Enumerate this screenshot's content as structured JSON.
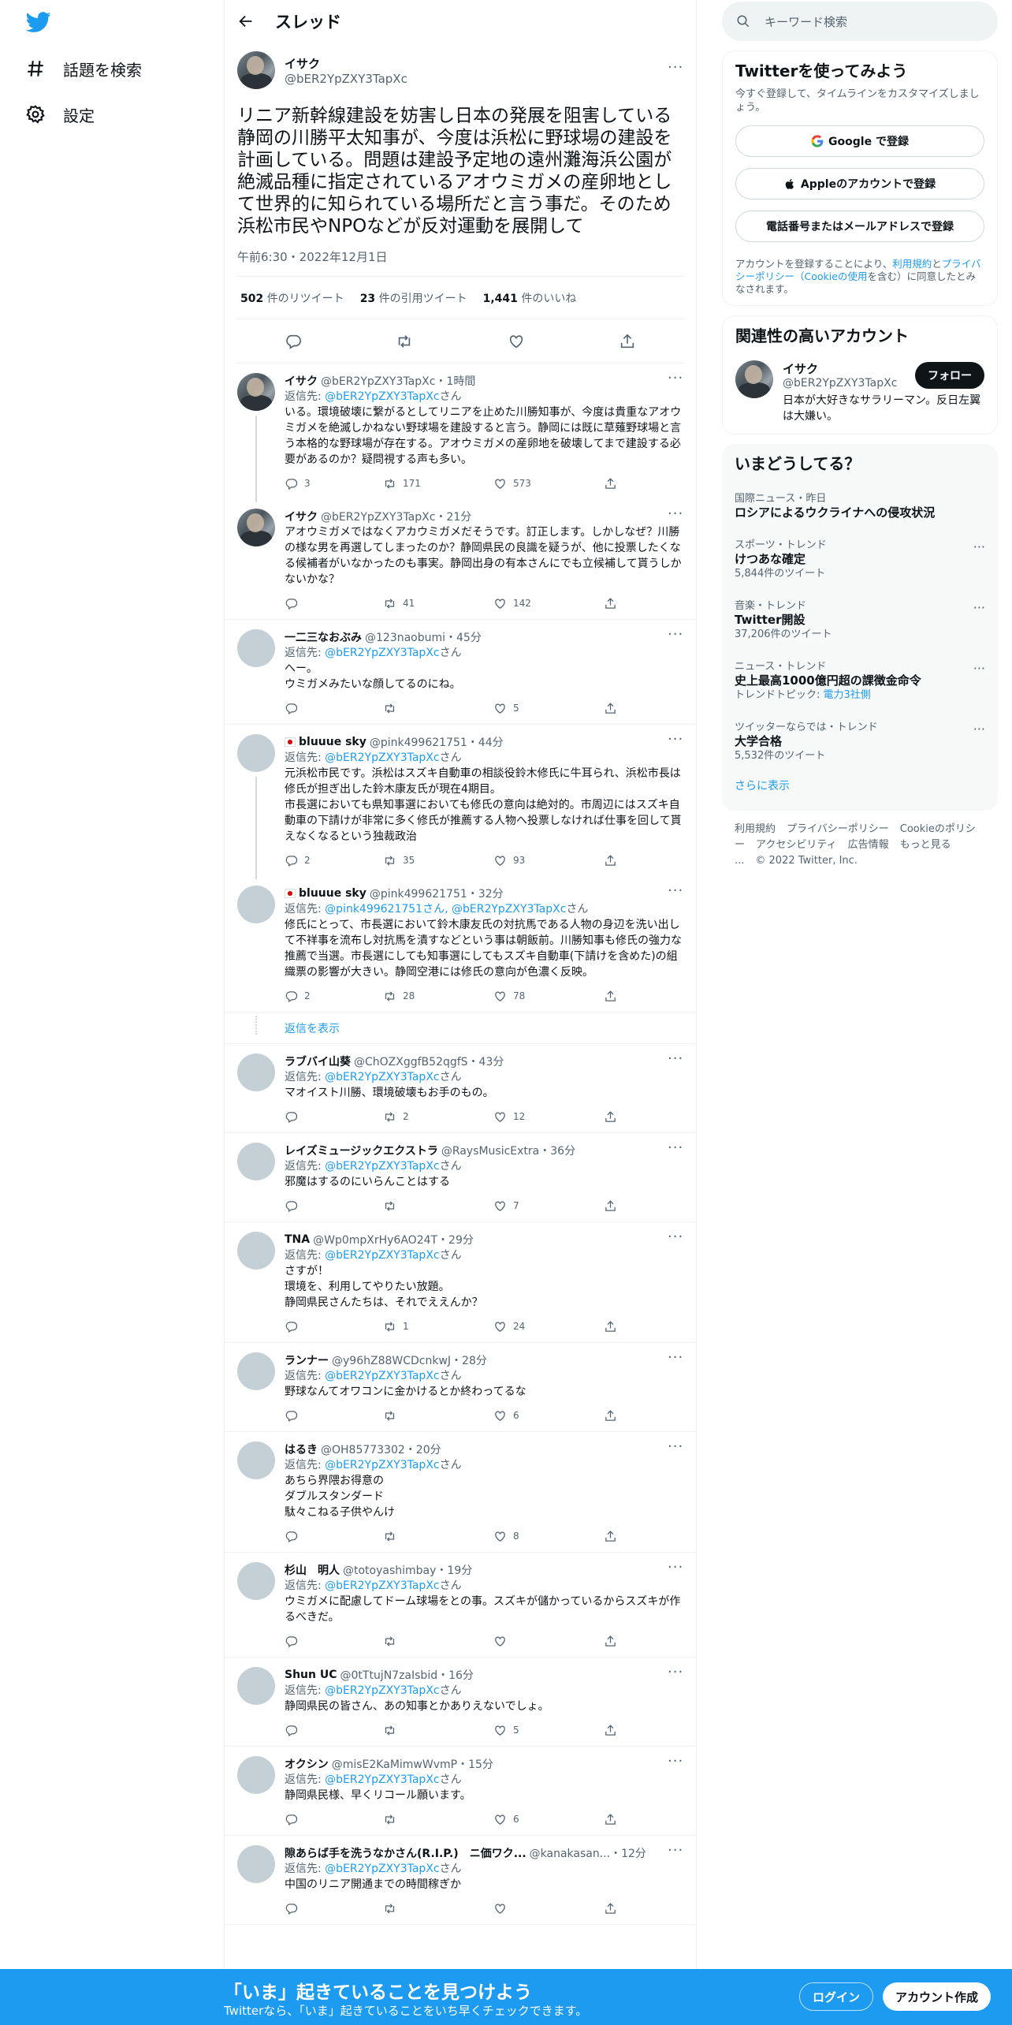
{
  "nav": {
    "items": [
      {
        "label": "話題を検索"
      },
      {
        "label": "設定"
      }
    ]
  },
  "header": {
    "title": "スレッド"
  },
  "tweet": {
    "name": "イサク",
    "handle": "@bER2YpZXY3TapXc",
    "text": "リニア新幹線建設を妨害し日本の発展を阻害している静岡の川勝平太知事が、今度は浜松に野球場の建設を計画している。問題は建設予定地の遠州灘海浜公園が絶滅品種に指定されているアオウミガメの産卵地として世界的に知られている場所だと言う事だ。そのため浜松市民やNPOなどが反対運動を展開して",
    "date": "午前6:30・2022年12月1日",
    "retweets": "502",
    "retweets_label": "件のリツイート",
    "quotes": "23",
    "quotes_label": "件の引用ツイート",
    "likes": "1,441",
    "likes_label": "件のいいね"
  },
  "reply_to_prefix": "返信先: ",
  "reply_suffix": "さん",
  "replies": [
    {
      "name": "イサク",
      "handle": "@bER2YpZXY3TapXc・1時間",
      "to": "@bER2YpZXY3TapXc",
      "text": "いる。環境破壊に繋がるとしてリニアを止めた川勝知事が、今度は貴重なアオウミガメを絶滅しかねない野球場を建設すると言う。静岡には既に草薙野球場と言う本格的な野球場が存在する。アオウミガメの産卵地を破壊してまで建設する必要があるのか？疑問視する声も多い。",
      "reply": "3",
      "rt": "171",
      "like": "573",
      "photo": true,
      "thread": true
    },
    {
      "name": "イサク",
      "handle": "@bER2YpZXY3TapXc・21分",
      "to": "",
      "text": "アオウミガメではなくアカウミガメだそうです。訂正します。しかしなぜ？川勝の様な男を再選してしまったのか？静岡県民の良識を疑うが、他に投票したくなる候補者がいなかったのも事実。静岡出身の有本さんにでも立候補して貰うしかないかな？",
      "reply": "",
      "rt": "41",
      "like": "142",
      "photo": true,
      "thread": false
    },
    {
      "name": "一二三なおぶみ",
      "handle": "@123naobumi・45分",
      "to": "@bER2YpZXY3TapXc",
      "text": "へー。\nウミガメみたいな顔してるのにね。",
      "reply": "",
      "rt": "",
      "like": "5",
      "photo": false,
      "thread": false
    },
    {
      "name": "bluuue sky",
      "handle": "@pink499621751・44分",
      "to": "@bER2YpZXY3TapXc",
      "text": "元浜松市民です。浜松はスズキ自動車の相談役鈴木修氏に牛耳られ、浜松市長は修氏が担ぎ出した鈴木康友氏が現在4期目。\n市長選においても県知事選においても修氏の意向は絶対的。市周辺にはスズキ自動車の下請けが非常に多く修氏が推薦する人物へ投票しなければ仕事を回して貰えなくなるという独裁政治",
      "reply": "2",
      "rt": "35",
      "like": "93",
      "photo": false,
      "thread": true,
      "flag": true
    },
    {
      "name": "bluuue sky",
      "handle": "@pink499621751・32分",
      "to": "@pink499621751さん, @bER2YpZXY3TapXc",
      "text": "修氏にとって、市長選において鈴木康友氏の対抗馬である人物の身辺を洗い出して不祥事を流布し対抗馬を潰すなどという事は朝飯前。川勝知事も修氏の強力な推薦で当選。市長選にしても知事選にしてもスズキ自動車(下請けを含めた)の組織票の影響が大きい。静岡空港には修氏の意向が色濃く反映。",
      "reply": "2",
      "rt": "28",
      "like": "78",
      "photo": false,
      "thread": false,
      "flag": true,
      "show_replies": "返信を表示"
    },
    {
      "name": "ラブバイ山葵",
      "handle": "@ChOZXggfB52qgfS・43分",
      "to": "@bER2YpZXY3TapXc",
      "text": "マオイスト川勝、環境破壊もお手のもの。",
      "reply": "",
      "rt": "2",
      "like": "12",
      "photo": false,
      "thread": false
    },
    {
      "name": "レイズミュージックエクストラ",
      "handle": "@RaysMusicExtra・36分",
      "to": "@bER2YpZXY3TapXc",
      "text": "邪魔はするのにいらんことはする",
      "reply": "",
      "rt": "",
      "like": "7",
      "photo": false,
      "thread": false
    },
    {
      "name": "TNA",
      "handle": "@Wp0mpXrHy6AO24T・29分",
      "to": "@bER2YpZXY3TapXc",
      "text": "さすが！\n環境を、利用してやりたい放題。\n静岡県民さんたちは、それでええんか？",
      "reply": "",
      "rt": "1",
      "like": "24",
      "photo": false,
      "thread": false
    },
    {
      "name": "ランナー",
      "handle": "@y96hZ88WCDcnkwJ・28分",
      "to": "@bER2YpZXY3TapXc",
      "text": "野球なんてオワコンに金かけるとか終わってるな",
      "reply": "",
      "rt": "",
      "like": "6",
      "photo": false,
      "thread": false
    },
    {
      "name": "はるき",
      "handle": "@OH85773302・20分",
      "to": "@bER2YpZXY3TapXc",
      "text": "あちら界隈お得意の\nダブルスタンダード\n駄々こねる子供やんけ",
      "reply": "",
      "rt": "",
      "like": "8",
      "photo": false,
      "thread": false
    },
    {
      "name": "杉山　明人",
      "handle": "@totoyashimbay・19分",
      "to": "@bER2YpZXY3TapXc",
      "text": "ウミガメに配慮してドーム球場をとの事。スズキが儲かっているからスズキが作るべきだ。",
      "reply": "",
      "rt": "",
      "like": "",
      "photo": false,
      "thread": false
    },
    {
      "name": "Shun UC",
      "handle": "@0tTtujN7zaIsbid・16分",
      "to": "@bER2YpZXY3TapXc",
      "text": "静岡県民の皆さん、あの知事とかありえないでしょ。",
      "reply": "",
      "rt": "",
      "like": "5",
      "photo": false,
      "thread": false
    },
    {
      "name": "オクシン",
      "handle": "@misE2KaMimwWvmP・15分",
      "to": "@bER2YpZXY3TapXc",
      "text": "静岡県民様、早くリコール願います。",
      "reply": "",
      "rt": "",
      "like": "6",
      "photo": false,
      "thread": false
    },
    {
      "name": "隙あらば手を洗うなかさん(R.I.P.)　ニ価ワク...",
      "handle": "@kanakasan...・12分",
      "to": "@bER2YpZXY3TapXc",
      "text": "中国のリニア開通までの時間稼ぎか",
      "reply": "",
      "rt": "",
      "like": "",
      "photo": false,
      "thread": false
    }
  ],
  "search": {
    "placeholder": "キーワード検索"
  },
  "signup": {
    "title": "Twitterを使ってみよう",
    "subtitle": "今すぐ登録して、タイムラインをカスタマイズしましょう。",
    "google": "Google で登録",
    "apple": "Appleのアカウントで登録",
    "email": "電話番号またはメールアドレスで登録",
    "legal_pre": "アカウントを登録することにより、",
    "terms": "利用規約",
    "and": "と",
    "privacy": "プライバシーポリシー（Cookieの使用",
    "legal_post": "を含む）に同意したとみなされます。"
  },
  "related": {
    "title": "関連性の高いアカウント",
    "name": "イサク",
    "handle": "@bER2YpZXY3TapXc",
    "follow": "フォロー",
    "bio": "日本が大好きなサラリーマン。反日左翼は大嫌い。"
  },
  "trends": {
    "title": "いまどうしてる？",
    "items": [
      {
        "meta": "国際ニュース・昨日",
        "title": "ロシアによるウクライナへの侵攻状況",
        "count": ""
      },
      {
        "meta": "スポーツ・トレンド",
        "title": "けつあな確定",
        "count": "5,844件のツイート"
      },
      {
        "meta": "音楽・トレンド",
        "title": "Twitter開設",
        "count": "37,206件のツイート"
      },
      {
        "meta": "ニュース・トレンド",
        "title": "史上最高1000億円超の課徴金命令",
        "count": "トレンドトピック: ",
        "link": "電力3社側"
      },
      {
        "meta": "ツイッターならでは・トレンド",
        "title": "大学合格",
        "count": "5,532件のツイート"
      }
    ],
    "more": "さらに表示"
  },
  "footer": {
    "links": [
      "利用規約",
      "プライバシーポリシー",
      "Cookieのポリシー",
      "アクセシビリティ",
      "広告情報",
      "もっと見る ...",
      "© 2022 Twitter, Inc."
    ]
  },
  "banner": {
    "title": "「いま」起きていることを見つけよう",
    "subtitle": "Twitterなら、「いま」起きていることをいち早くチェックできます。",
    "login": "ログイン",
    "signup": "アカウント作成"
  },
  "colors": {
    "accent": "#1d9bf0",
    "text": "#0f1419",
    "muted": "#536471"
  }
}
